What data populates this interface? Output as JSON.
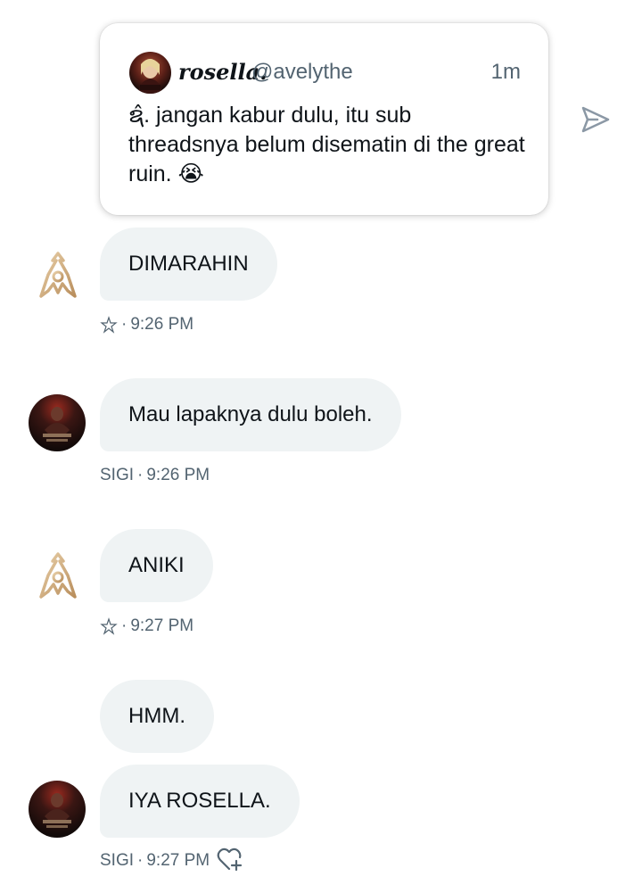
{
  "quote": {
    "name": "rosella.",
    "handle": "@avelythe",
    "time": "1m",
    "text": "ຊ̂. jangan kabur dulu, itu sub threadsnya belum disematin di the great ruin. 😭",
    "avatar_icon": "profile-portrait"
  },
  "messages": [
    {
      "text": "DIMARAHIN",
      "sender": "",
      "time": "9:26 PM",
      "sender_icon": "star-icon",
      "avatar_icon": "golden-emblem-logo"
    },
    {
      "text": "Mau lapaknya dulu boleh.",
      "sender": "SIGI",
      "time": "9:26 PM",
      "avatar_icon": "dark-book-cover-avatar"
    },
    {
      "text": "ANIKI",
      "sender": "",
      "time": "9:27 PM",
      "sender_icon": "star-icon",
      "avatar_icon": "golden-emblem-logo"
    },
    {
      "text": "HMM.",
      "sender": "",
      "time": ""
    },
    {
      "text": "IYA ROSELLA.",
      "sender": "SIGI",
      "time": "9:27 PM",
      "avatar_icon": "dark-book-cover-avatar"
    }
  ],
  "meta_separator": "·",
  "colors": {
    "bubble_bg": "#eff3f4",
    "text_primary": "#0f1419",
    "text_secondary": "#536471",
    "logo_gold": "#c9a57a"
  }
}
